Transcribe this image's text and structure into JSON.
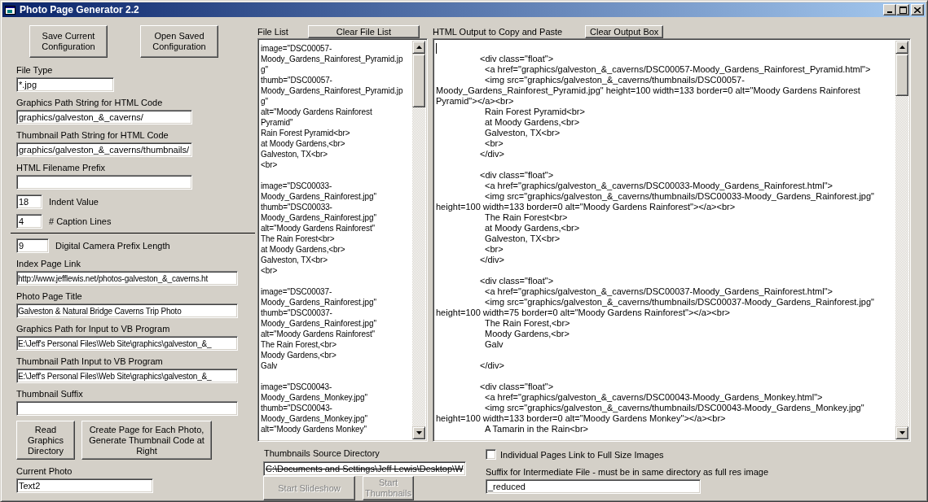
{
  "window": {
    "title": "Photo Page Generator 2.2"
  },
  "config_buttons": [
    {
      "label": "Save Current Configuration"
    },
    {
      "label": "Open Saved Configuration"
    }
  ],
  "settings": {
    "file_type": {
      "label": "File Type",
      "value": "*.jpg"
    },
    "graphics_path_html": {
      "label": "Graphics Path String for HTML Code",
      "value": "graphics/galveston_&_caverns/"
    },
    "thumbnail_path_html": {
      "label": "Thumbnail Path String for HTML Code",
      "value": "graphics/galveston_&_caverns/thumbnails/"
    },
    "html_filename_prefix": {
      "label": "HTML Filename Prefix"
    },
    "indent_value": {
      "label": "Indent Value",
      "value": "18"
    },
    "caption_lines": {
      "label": "# Caption Lines",
      "value": "4"
    },
    "camera_prefix_length": {
      "label": "Digital Camera Prefix Length",
      "value": "9"
    },
    "index_page_link": {
      "label": "Index Page Link",
      "value": "http://www.jefflewis.net/photos-galveston_&_caverns.ht"
    },
    "photo_page_title": {
      "label": "Photo Page Title",
      "value": "Galveston & Natural Bridge Caverns Trip Photo"
    },
    "graphics_path_input": {
      "label": "Graphics Path for Input to VB Program",
      "value": "E:\\Jeff's Personal Files\\Web Site\\graphics\\galveston_&_"
    },
    "thumbnail_path_input": {
      "label": "Thumbnail Path Input to VB Program",
      "value": "E:\\Jeff's Personal Files\\Web Site\\graphics\\galveston_&_"
    },
    "thumbnail_suffix": {
      "label": "Thumbnail Suffix"
    }
  },
  "action_buttons": [
    {
      "label": "Read Graphics Directory"
    },
    {
      "label": "Create Page for Each Photo, Generate Thumbnail Code at Right"
    }
  ],
  "current_photo": {
    "label": "Current Photo",
    "value": "Text2"
  },
  "file_list": {
    "label": "File List",
    "clear_button": "Clear File List",
    "blocks": [
      [
        "image=\"DSC00057-",
        "Moody_Gardens_Rainforest_Pyramid.jp",
        "g\"",
        "thumb=\"DSC00057-",
        "Moody_Gardens_Rainforest_Pyramid.jp",
        "g\"",
        "alt=\"Moody Gardens Rainforest",
        "Pyramid\"",
        "Rain Forest Pyramid<br>",
        "at Moody Gardens,<br>",
        "Galveston, TX<br>",
        "<br>"
      ],
      [
        "image=\"DSC00033-",
        "Moody_Gardens_Rainforest.jpg\"",
        "thumb=\"DSC00033-",
        "Moody_Gardens_Rainforest.jpg\"",
        "alt=\"Moody Gardens Rainforest\"",
        "The Rain Forest<br>",
        "at Moody Gardens,<br>",
        "Galveston, TX<br>",
        "<br>"
      ],
      [
        "image=\"DSC00037-",
        "Moody_Gardens_Rainforest.jpg\"",
        "thumb=\"DSC00037-",
        "Moody_Gardens_Rainforest.jpg\"",
        "alt=\"Moody Gardens Rainforest\"",
        "The Rain Forest,<br>",
        "Moody Gardens,<br>",
        "Galv"
      ],
      [
        "image=\"DSC00043-",
        "Moody_Gardens_Monkey.jpg\"",
        "thumb=\"DSC00043-",
        "Moody_Gardens_Monkey.jpg\"",
        "alt=\"Moody Gardens Monkey\""
      ]
    ]
  },
  "thumbnails_source": {
    "label": "Thumbnails Source Directory",
    "value": "C:\\Documents and Settings\\Jeff Lewis\\Desktop\\W",
    "strikethrough": true
  },
  "slideshow_buttons": [
    {
      "label": "Start Slideshow",
      "disabled": true
    },
    {
      "label": "Start Thumbnails",
      "disabled": true
    }
  ],
  "html_output": {
    "label": "HTML Output to Copy and Paste",
    "clear_button": "Clear Output Box",
    "caret": true,
    "blocks": [
      [
        {
          "kind": "outer",
          "text": "<div class=\"float\">"
        },
        {
          "kind": "inner",
          "text": "<a href=\"graphics/galveston_&_caverns/DSC00057-Moody_Gardens_Rainforest_Pyramid.html\">"
        },
        {
          "kind": "inner",
          "text": "<img src=\"graphics/galveston_&_caverns/thumbnails/DSC00057-"
        },
        {
          "kind": "wrap",
          "text": "Moody_Gardens_Rainforest_Pyramid.jpg\" height=100 width=133 border=0 alt=\"Moody Gardens Rainforest"
        },
        {
          "kind": "wrap",
          "text": "Pyramid\"></a><br>"
        },
        {
          "kind": "inner",
          "text": "Rain Forest Pyramid<br>"
        },
        {
          "kind": "inner",
          "text": "at Moody Gardens,<br>"
        },
        {
          "kind": "inner",
          "text": "Galveston, TX<br>"
        },
        {
          "kind": "inner",
          "text": "<br>"
        },
        {
          "kind": "outer",
          "text": "</div>"
        }
      ],
      [
        {
          "kind": "outer",
          "text": "<div class=\"float\">"
        },
        {
          "kind": "inner",
          "text": "<a href=\"graphics/galveston_&_caverns/DSC00033-Moody_Gardens_Rainforest.html\">"
        },
        {
          "kind": "inner",
          "text": "<img src=\"graphics/galveston_&_caverns/thumbnails/DSC00033-Moody_Gardens_Rainforest.jpg\""
        },
        {
          "kind": "wrap",
          "text": "height=100 width=133 border=0 alt=\"Moody Gardens Rainforest\"></a><br>"
        },
        {
          "kind": "inner",
          "text": "The Rain Forest<br>"
        },
        {
          "kind": "inner",
          "text": "at Moody Gardens,<br>"
        },
        {
          "kind": "inner",
          "text": "Galveston, TX<br>"
        },
        {
          "kind": "inner",
          "text": "<br>"
        },
        {
          "kind": "outer",
          "text": "</div>"
        }
      ],
      [
        {
          "kind": "outer",
          "text": "<div class=\"float\">"
        },
        {
          "kind": "inner",
          "text": "<a href=\"graphics/galveston_&_caverns/DSC00037-Moody_Gardens_Rainforest.html\">"
        },
        {
          "kind": "inner",
          "text": "<img src=\"graphics/galveston_&_caverns/thumbnails/DSC00037-Moody_Gardens_Rainforest.jpg\""
        },
        {
          "kind": "wrap",
          "text": "height=100 width=75 border=0 alt=\"Moody Gardens Rainforest\"></a><br>"
        },
        {
          "kind": "inner",
          "text": "The Rain Forest,<br>"
        },
        {
          "kind": "inner",
          "text": "Moody Gardens,<br>"
        },
        {
          "kind": "inner",
          "text": "Galv"
        },
        {
          "kind": "blank"
        },
        {
          "kind": "outer",
          "text": "</div>"
        }
      ],
      [
        {
          "kind": "outer",
          "text": "<div class=\"float\">"
        },
        {
          "kind": "inner",
          "text": "<a href=\"graphics/galveston_&_caverns/DSC00043-Moody_Gardens_Monkey.html\">"
        },
        {
          "kind": "inner",
          "text": "<img src=\"graphics/galveston_&_caverns/thumbnails/DSC00043-Moody_Gardens_Monkey.jpg\""
        },
        {
          "kind": "wrap",
          "text": "height=100 width=133 border=0 alt=\"Moody Gardens Monkey\"></a><br>"
        },
        {
          "kind": "inner",
          "text": "A Tamarin in the Rain<br>"
        }
      ]
    ]
  },
  "full_size_links": {
    "label": "Individual Pages Link to Full Size Images",
    "checked": false
  },
  "intermediate_suffix": {
    "label": "Suffix for Intermediate File - must be in same directory as full res image",
    "value": "_reduced"
  }
}
